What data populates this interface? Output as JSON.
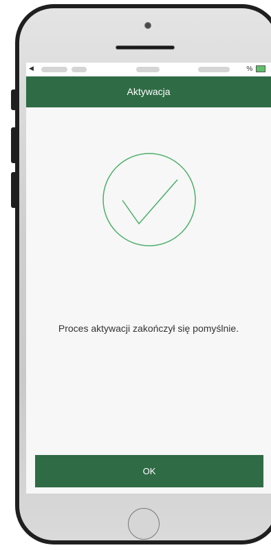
{
  "device": {
    "status_bar": {
      "battery_text": "%",
      "battery_icon": "battery-charging-icon"
    }
  },
  "header": {
    "title": "Aktywacja"
  },
  "main": {
    "success_icon": "checkmark-circle-icon",
    "message": "Proces aktywacji zakończył się pomyślnie."
  },
  "footer": {
    "ok_label": "OK"
  },
  "colors": {
    "brand_green": "#2f6b45",
    "check_green": "#4caf6a",
    "screen_background": "#f7f7f7"
  }
}
